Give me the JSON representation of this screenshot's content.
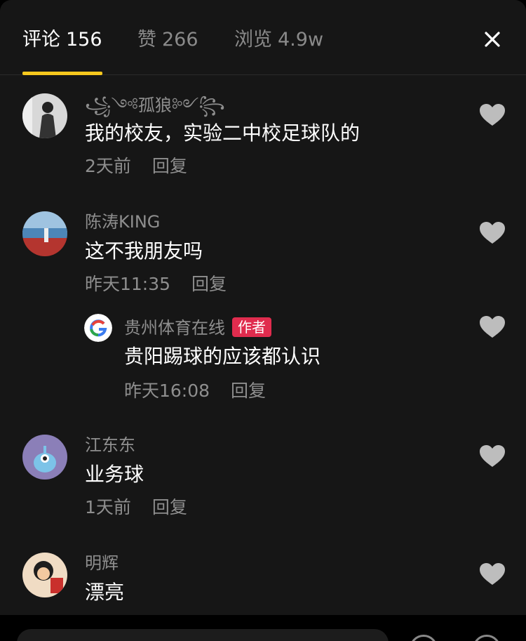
{
  "tabs": [
    {
      "label": "评论",
      "count": "156",
      "active": true
    },
    {
      "label": "赞",
      "count": "266",
      "active": false
    },
    {
      "label": "浏览",
      "count": "4.9w",
      "active": false
    }
  ],
  "comments": [
    {
      "name": "꧁༺孤狼༻꧂",
      "text": "我的校友，实验二中校足球队的",
      "time": "2天前",
      "reply": "回复"
    },
    {
      "name": "陈涛KING",
      "text": "这不我朋友吗",
      "time": "昨天11:35",
      "reply": "回复"
    },
    {
      "name": "贵州体育在线",
      "badge": "作者",
      "text": "贵阳踢球的应该都认识",
      "time": "昨天16:08",
      "reply": "回复"
    },
    {
      "name": "江东东",
      "text": "业务球",
      "time": "1天前",
      "reply": "回复"
    },
    {
      "name": "明辉",
      "text": "漂亮"
    }
  ],
  "colors": {
    "accent": "#f7c81e",
    "badge": "#e02c4e",
    "panel": "#161616",
    "muted": "#8e8e8e"
  },
  "icons": [
    "close-icon",
    "heart-icon",
    "avatar-placeholder"
  ]
}
